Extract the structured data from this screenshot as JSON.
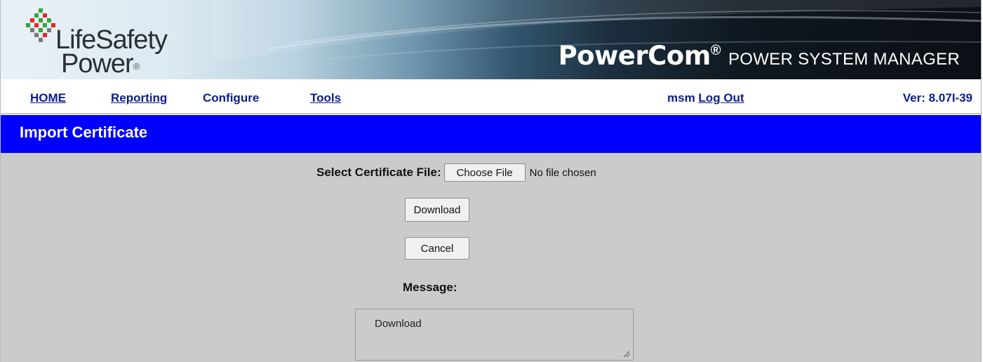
{
  "banner": {
    "logo_line1": "LifeSafety",
    "logo_line2": "Power",
    "logo_reg": "®",
    "product_brand": "PowerCom",
    "product_reg": "®",
    "product_subtitle": "POWER SYSTEM MANAGER"
  },
  "nav": {
    "home": "HOME",
    "reporting": "Reporting",
    "configure": "Configure",
    "tools": "Tools",
    "username": "msm",
    "logout": "Log Out",
    "version": "Ver: 8.07I-39"
  },
  "page": {
    "title": "Import Certificate"
  },
  "form": {
    "select_label": "Select Certificate File:",
    "choose_file": "Choose File",
    "no_file": "No file chosen",
    "download": "Download",
    "cancel": "Cancel",
    "message_label": "Message:",
    "message_value": "Download"
  },
  "colors": {
    "title_bar": "#0000ff",
    "nav_link": "#0b1d8f",
    "content_bg": "#cbcbcb"
  }
}
